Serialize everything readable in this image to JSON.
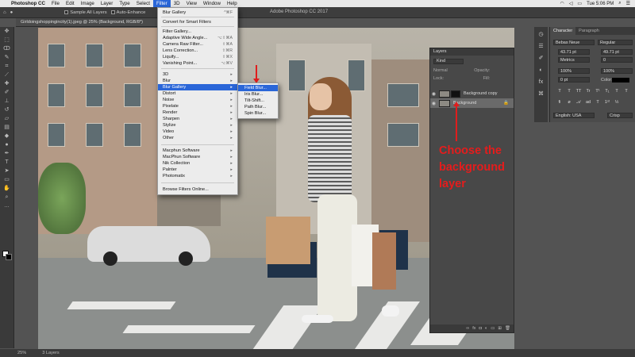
{
  "menubar": {
    "app_name": "Photoshop CC",
    "items": [
      "File",
      "Edit",
      "Image",
      "Layer",
      "Type",
      "Select",
      "Filter",
      "3D",
      "View",
      "Window",
      "Help"
    ],
    "active_item": "Filter",
    "clock": "Tue 5:06 PM"
  },
  "options_bar": {
    "sample_all_layers": "Sample All Layers",
    "auto_enhance": "Auto-Enhance",
    "window_title": "Adobe Photoshop CC 2017"
  },
  "document_tab": "Girldoingshoppingincity(1).jpeg @ 25% (Background, RGB/8*)",
  "filter_menu": {
    "items": [
      {
        "label": "Blur Gallery",
        "shortcut": "^⌘F"
      },
      {
        "label": "Convert for Smart Filters",
        "shortcut": ""
      },
      {
        "label": "Filter Gallery...",
        "shortcut": ""
      },
      {
        "label": "Adaptive Wide Angle...",
        "shortcut": "⌥⇧⌘A"
      },
      {
        "label": "Camera Raw Filter...",
        "shortcut": "⇧⌘A"
      },
      {
        "label": "Lens Correction...",
        "shortcut": "⇧⌘R"
      },
      {
        "label": "Liquify...",
        "shortcut": "⇧⌘X"
      },
      {
        "label": "Vanishing Point...",
        "shortcut": "⌥⌘V"
      },
      {
        "label": "3D",
        "shortcut": "▸"
      },
      {
        "label": "Blur",
        "shortcut": "▸"
      },
      {
        "label": "Blur Gallery",
        "shortcut": "▸"
      },
      {
        "label": "Distort",
        "shortcut": "▸"
      },
      {
        "label": "Noise",
        "shortcut": "▸"
      },
      {
        "label": "Pixelate",
        "shortcut": "▸"
      },
      {
        "label": "Render",
        "shortcut": "▸"
      },
      {
        "label": "Sharpen",
        "shortcut": "▸"
      },
      {
        "label": "Stylize",
        "shortcut": "▸"
      },
      {
        "label": "Video",
        "shortcut": "▸"
      },
      {
        "label": "Other",
        "shortcut": "▸"
      },
      {
        "label": "Macphun Software",
        "shortcut": "▸"
      },
      {
        "label": "MacPhun Software",
        "shortcut": "▸"
      },
      {
        "label": "Nik Collection",
        "shortcut": "▸"
      },
      {
        "label": "Palnter",
        "shortcut": "▸"
      },
      {
        "label": "Photomatix",
        "shortcut": "▸"
      },
      {
        "label": "Browse Filters Online...",
        "shortcut": ""
      }
    ]
  },
  "blur_gallery_submenu": [
    "Field Blur...",
    "Iris Blur...",
    "Tilt-Shift...",
    "Path Blur...",
    "Spin Blur..."
  ],
  "character_panel": {
    "tabs": [
      "Character",
      "Paragraph"
    ],
    "font_family": "Bebas Neue",
    "font_style": "Regular",
    "font_size": "43.71 pt",
    "leading": "49.71 pt",
    "kerning": "Metrics",
    "tracking": "0",
    "vertical_scale": "100%",
    "horizontal_scale": "100%",
    "baseline_shift": "0 pt",
    "color_label": "Color:",
    "type_buttons": [
      "T",
      "T",
      "TT",
      "Tr",
      "T¹",
      "T₁",
      "T",
      "T"
    ],
    "language": "English: USA",
    "antialias": "Crisp"
  },
  "layers_panel": {
    "title": "Layers",
    "kind_filter": "Kind",
    "blend_mode": "Normal",
    "opacity_label": "Opacity:",
    "lock_label": "Lock:",
    "fill_label": "Fill:",
    "layers": [
      {
        "name": "Background copy",
        "selected": false
      },
      {
        "name": "Background",
        "selected": true
      }
    ]
  },
  "annotation": {
    "lines": [
      "Choose the",
      "background",
      "layer"
    ],
    "color": "#e51c1c"
  },
  "status_bar": {
    "zoom": "25%",
    "info": "3 Layers"
  }
}
